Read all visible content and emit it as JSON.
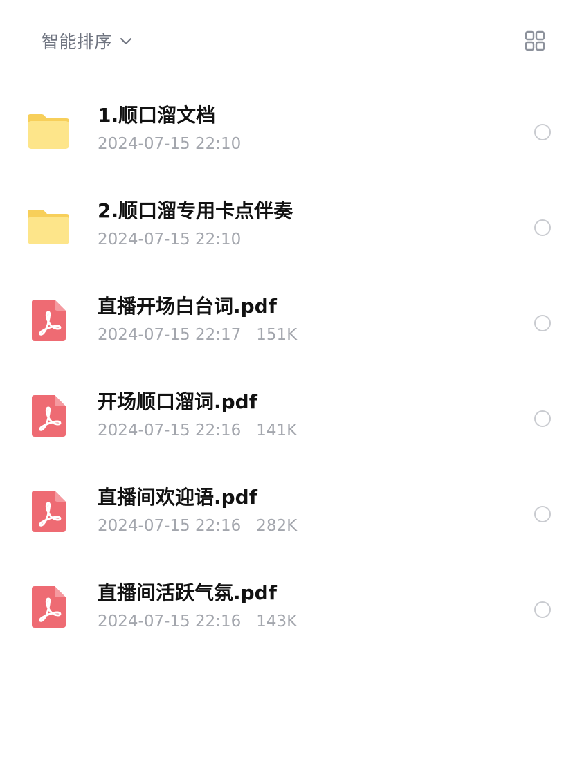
{
  "toolbar": {
    "sort_label": "智能排序",
    "sort_icon": "chevron-down-icon",
    "view_toggle_icon": "grid-view-icon"
  },
  "files": [
    {
      "name": "1.顺口溜文档",
      "date": "2024-07-15 22:10",
      "size": "",
      "type": "folder"
    },
    {
      "name": "2.顺口溜专用卡点伴奏",
      "date": "2024-07-15 22:10",
      "size": "",
      "type": "folder"
    },
    {
      "name": "直播开场白台词.pdf",
      "date": "2024-07-15 22:17",
      "size": "151K",
      "type": "pdf"
    },
    {
      "name": "开场顺口溜词.pdf",
      "date": "2024-07-15 22:16",
      "size": "141K",
      "type": "pdf"
    },
    {
      "name": "直播间欢迎语.pdf",
      "date": "2024-07-15 22:16",
      "size": "282K",
      "type": "pdf"
    },
    {
      "name": "直播间活跃气氛.pdf",
      "date": "2024-07-15 22:16",
      "size": "143K",
      "type": "pdf"
    }
  ],
  "colors": {
    "folder_light": "#fde58a",
    "folder_dark": "#f7cf5a",
    "pdf_red": "#ee6b73",
    "meta_gray": "#a3a6ad",
    "radio_border": "#c9cbd0"
  }
}
